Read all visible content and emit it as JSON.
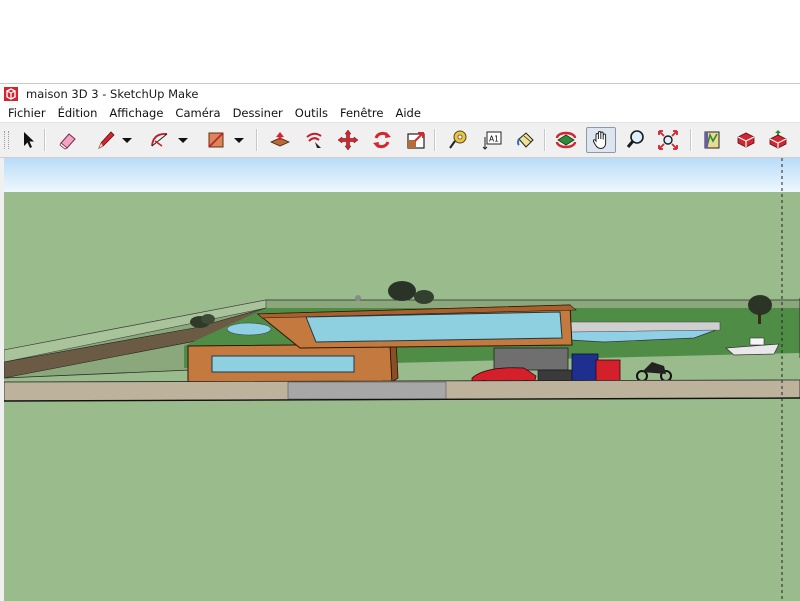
{
  "window": {
    "title": "maison 3D 3 - SketchUp Make",
    "app_icon": "sketchup-logo-icon"
  },
  "menu": {
    "items": [
      {
        "label": "Fichier"
      },
      {
        "label": "Édition"
      },
      {
        "label": "Affichage"
      },
      {
        "label": "Caméra"
      },
      {
        "label": "Dessiner"
      },
      {
        "label": "Outils"
      },
      {
        "label": "Fenêtre"
      },
      {
        "label": "Aide"
      }
    ]
  },
  "toolbar": {
    "tools": [
      {
        "name": "select-tool",
        "icon": "arrow-cursor-icon"
      },
      {
        "name": "eraser-tool",
        "icon": "eraser-icon"
      },
      {
        "name": "pencil-line-tool",
        "icon": "pencil-icon"
      },
      {
        "name": "arc-tool",
        "icon": "arc-icon"
      },
      {
        "name": "rectangle-tool",
        "icon": "rectangle-icon"
      },
      {
        "name": "push-pull-tool",
        "icon": "push-pull-icon"
      },
      {
        "name": "offset-tool",
        "icon": "offset-icon"
      },
      {
        "name": "move-tool",
        "icon": "move-arrows-icon"
      },
      {
        "name": "rotate-tool",
        "icon": "rotate-icon"
      },
      {
        "name": "scale-tool",
        "icon": "scale-icon"
      },
      {
        "name": "tape-measure-tool",
        "icon": "tape-measure-icon"
      },
      {
        "name": "text-tool",
        "icon": "text-label-icon"
      },
      {
        "name": "paint-bucket-tool",
        "icon": "paint-bucket-icon"
      },
      {
        "name": "orbit-tool",
        "icon": "orbit-icon"
      },
      {
        "name": "pan-tool",
        "icon": "hand-icon",
        "active": true
      },
      {
        "name": "zoom-tool",
        "icon": "magnifier-icon"
      },
      {
        "name": "zoom-extents-tool",
        "icon": "zoom-extents-icon"
      },
      {
        "name": "warehouse-tool",
        "icon": "warehouse-icon"
      },
      {
        "name": "extension-warehouse-tool",
        "icon": "extension-warehouse-icon"
      },
      {
        "name": "share-model-tool",
        "icon": "share-model-icon"
      }
    ],
    "text_tool_glyph": "A1"
  },
  "colors": {
    "sky_top": "#b9dcf8",
    "sky_bottom": "#eef7ff",
    "ground": "#9abb8c",
    "road": "#bdb39c",
    "lawn": "#4f8d47",
    "wood": "#c47a3e",
    "glass": "#8ecfe0",
    "pool": "#8fd0e6",
    "accent_red": "#d4202a"
  }
}
